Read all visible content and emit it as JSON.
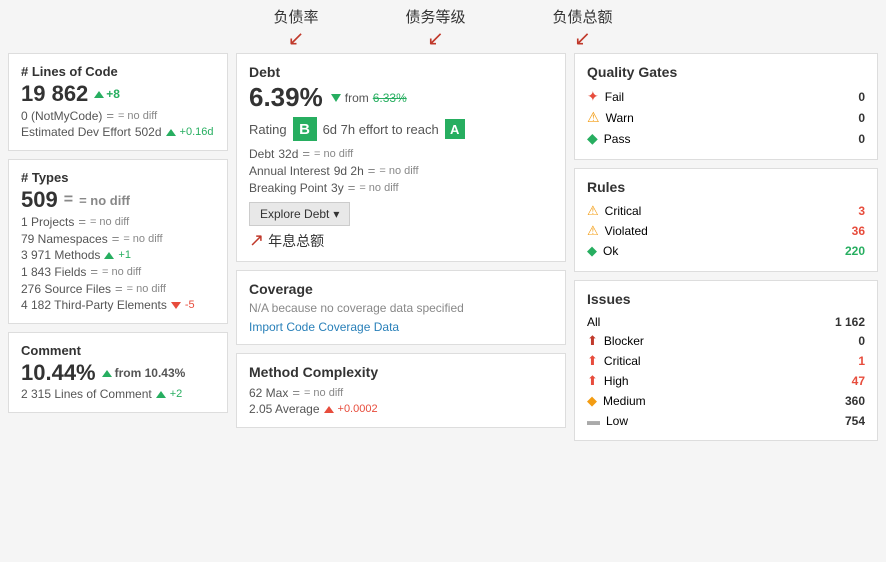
{
  "annotations": {
    "label1": "负债率",
    "label2": "债务等级",
    "label3": "负债总额",
    "label4": "年息总额"
  },
  "left": {
    "loc_title": "# Lines of Code",
    "loc_value": "19 862",
    "loc_delta": "+8",
    "loc_notmine": "0  (NotMyCode)",
    "loc_nodiff": "= no diff",
    "loc_effort": "Estimated Dev Effort",
    "loc_effort_val": "502d",
    "loc_effort_delta": "+0.16d",
    "types_title": "# Types",
    "types_value": "509",
    "types_nodiff": "= no diff",
    "types_projects": "1  Projects",
    "types_projects_nd": "= no diff",
    "types_namespaces": "79  Namespaces",
    "types_namespaces_nd": "= no diff",
    "types_methods": "3 971  Methods",
    "types_methods_delta": "+1",
    "types_fields": "1 843  Fields",
    "types_fields_nd": "= no diff",
    "types_source": "276  Source Files",
    "types_source_nd": "= no diff",
    "types_thirdparty": "4 182  Third-Party Elements",
    "types_thirdparty_delta": "-5",
    "comment_title": "Comment",
    "comment_value": "10.44%",
    "comment_from": "from 10.43%",
    "comment_lines": "2 315  Lines of Comment",
    "comment_lines_delta": "+2"
  },
  "middle": {
    "debt_title": "Debt",
    "debt_percent": "6.39%",
    "debt_from_label": "from",
    "debt_from_val": "6.33%",
    "rating_label": "Rating",
    "rating_val": "B",
    "effort_text": "6d 7h effort to reach",
    "target_rating": "A",
    "debt_days_label": "Debt",
    "debt_days_val": "32d",
    "debt_days_nd": "= no diff",
    "annual_label": "Annual Interest",
    "annual_val": "9d 2h",
    "annual_nd": "= no diff",
    "breaking_label": "Breaking Point",
    "breaking_val": "3y",
    "breaking_nd": "= no diff",
    "explore_btn": "Explore Debt",
    "coverage_title": "Coverage",
    "coverage_na": "N/A because no coverage data specified",
    "coverage_link": "Import Code Coverage Data",
    "complexity_title": "Method Complexity",
    "complexity_max_label": "62  Max",
    "complexity_max_nd": "= no diff",
    "complexity_avg_label": "2.05  Average",
    "complexity_avg_delta": "+0.0002"
  },
  "right": {
    "qg_title": "Quality Gates",
    "qg_fail_label": "Fail",
    "qg_fail_count": "0",
    "qg_warn_label": "Warn",
    "qg_warn_count": "0",
    "qg_pass_label": "Pass",
    "qg_pass_count": "0",
    "rules_title": "Rules",
    "rules_critical_label": "Critical",
    "rules_critical_count": "3",
    "rules_violated_label": "Violated",
    "rules_violated_count": "36",
    "rules_ok_label": "Ok",
    "rules_ok_count": "220",
    "issues_title": "Issues",
    "issues_all_label": "All",
    "issues_all_count": "1 162",
    "issues_blocker_label": "Blocker",
    "issues_blocker_count": "0",
    "issues_critical_label": "Critical",
    "issues_critical_count": "1",
    "issues_high_label": "High",
    "issues_high_count": "47",
    "issues_medium_label": "Medium",
    "issues_medium_count": "360",
    "issues_low_label": "Low",
    "issues_low_count": "754"
  }
}
